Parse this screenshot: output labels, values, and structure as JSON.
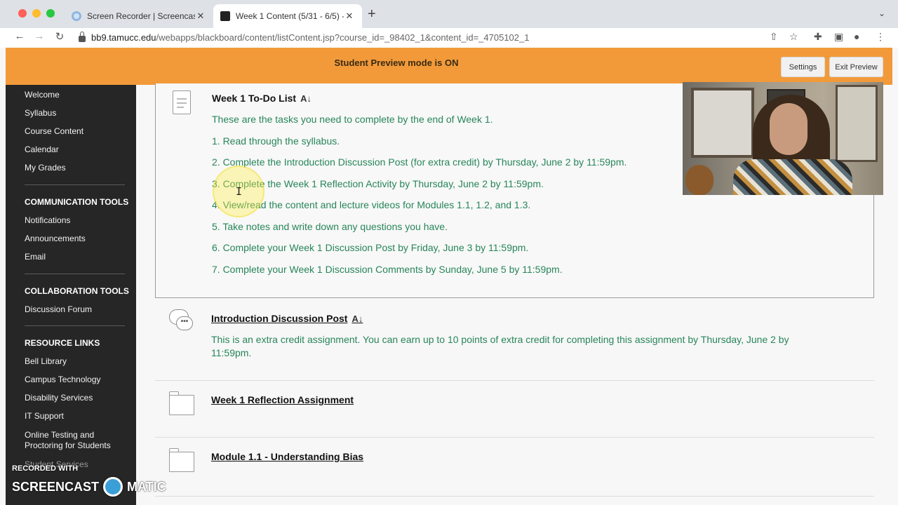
{
  "browser": {
    "tabs": [
      {
        "title": "Screen Recorder | Screencast-"
      },
      {
        "title": "Week 1 Content (5/31 - 6/5) - "
      }
    ],
    "new_tab_icon": "+",
    "address_host": "bb9.tamucc.edu",
    "address_path": "/webapps/blackboard/content/listContent.jsp?course_id=_98402_1&content_id=_4705102_1"
  },
  "banner": {
    "text": "Student Preview mode is ON",
    "settings_label": "Settings",
    "exit_label": "Exit Preview",
    "color": "#f29a3a"
  },
  "sidebar": {
    "top_links": [
      "Welcome",
      "Syllabus",
      "Course Content",
      "Calendar",
      "My Grades"
    ],
    "sections": [
      {
        "heading": "COMMUNICATION TOOLS",
        "links": [
          "Notifications",
          "Announcements",
          "Email"
        ]
      },
      {
        "heading": "COLLABORATION TOOLS",
        "links": [
          "Discussion Forum"
        ]
      },
      {
        "heading": "RESOURCE LINKS",
        "links": [
          "Bell Library",
          "Campus Technology",
          "Disability Services",
          "IT Support",
          "Online Testing and Proctoring for Students",
          "Student Services"
        ]
      }
    ]
  },
  "content": {
    "items": [
      {
        "title": "Week 1 To-Do List",
        "icon": "document-icon",
        "lines": [
          "These are the tasks you need to complete by the end of Week 1.",
          "1. Read through the syllabus.",
          "2. Complete the Introduction Discussion Post (for extra credit) by Thursday, June 2 by 11:59pm.",
          "3. Complete the Week 1 Reflection Activity by Thursday, June 2 by 11:59pm.",
          "4. View/read the content and lecture videos for Modules 1.1, 1.2, and 1.3.",
          "5. Take notes and write down any questions you have.",
          "6. Complete your Week 1 Discussion Post by Friday, June 3 by 11:59pm.",
          "7. Complete your Week 1 Discussion Comments by Sunday, June 5 by 11:59pm."
        ]
      },
      {
        "title": "Introduction Discussion Post",
        "icon": "discussion-icon",
        "lines": [
          "This is an extra credit assignment. You can earn up to 10 points of extra credit for completing this assignment by Thursday, June 2 by",
          "11:59pm."
        ]
      },
      {
        "title": "Week 1 Reflection Assignment",
        "icon": "folder-icon"
      },
      {
        "title": "Module 1.1 - Understanding Bias",
        "icon": "folder-icon"
      }
    ],
    "text_color": "#27855a"
  },
  "watermark": {
    "small": "RECORDED WITH",
    "left": "SCREENCAST",
    "right": "MATIC"
  }
}
